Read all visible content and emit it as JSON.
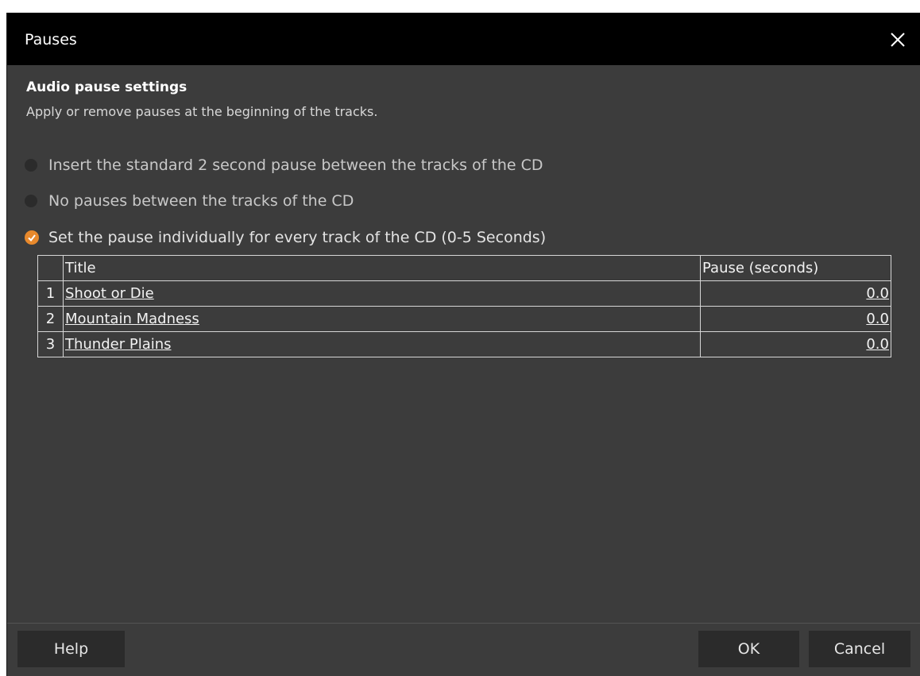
{
  "window": {
    "title": "Pauses"
  },
  "header": {
    "heading": "Audio pause settings",
    "description": "Apply or remove pauses at the beginning of the tracks."
  },
  "options": [
    {
      "label": "Insert the standard 2 second pause between the tracks of the CD",
      "selected": false
    },
    {
      "label": "No pauses between the tracks of the CD",
      "selected": false
    },
    {
      "label": "Set the pause individually for every track of the CD (0-5 Seconds)",
      "selected": true
    }
  ],
  "table": {
    "headers": {
      "number": "",
      "title": "Title",
      "pause": "Pause (seconds)"
    },
    "rows": [
      {
        "number": "1",
        "title": "Shoot or Die",
        "pause": "0.0"
      },
      {
        "number": "2",
        "title": "Mountain Madness",
        "pause": "0.0"
      },
      {
        "number": "3",
        "title": "Thunder Plains",
        "pause": "0.0"
      }
    ]
  },
  "buttons": {
    "help": "Help",
    "ok": "OK",
    "cancel": "Cancel"
  },
  "colors": {
    "accent": "#e8892c",
    "background": "#3c3c3c",
    "titlebar": "#000000"
  },
  "icons": {
    "close": "close-icon",
    "check": "check-icon"
  }
}
